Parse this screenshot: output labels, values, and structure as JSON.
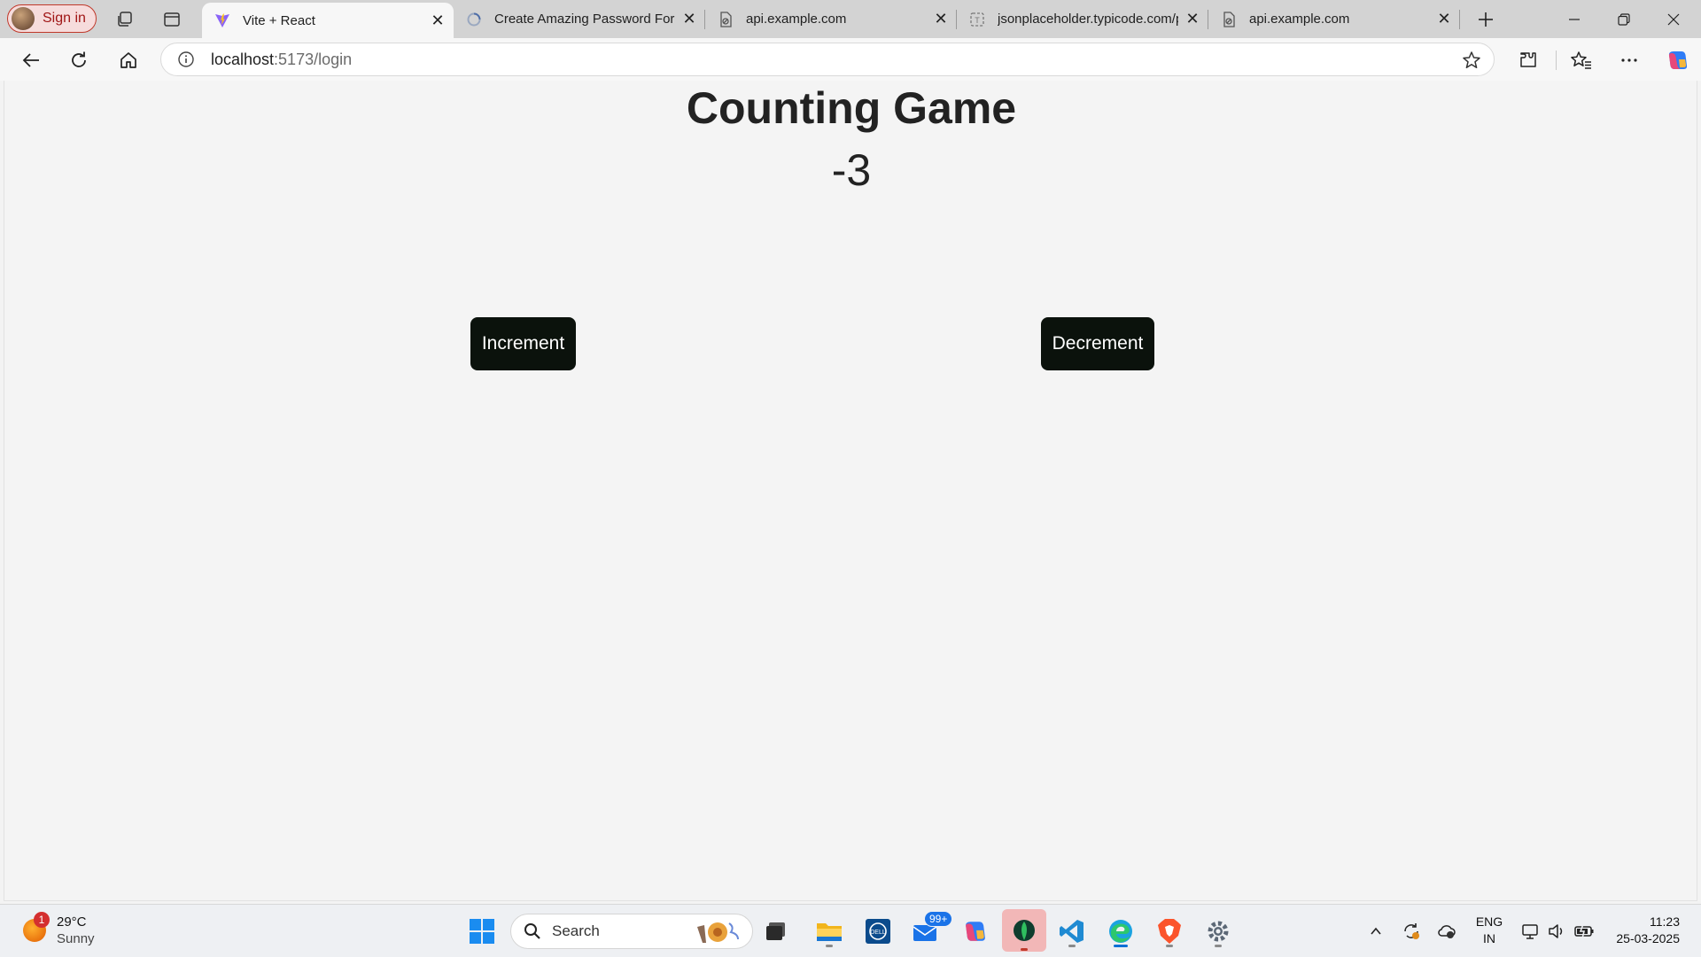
{
  "browser": {
    "signin_label": "Sign in",
    "tabs": [
      {
        "title": "Vite + React",
        "favicon": "vite-icon",
        "active": true
      },
      {
        "title": "Create Amazing Password Form",
        "favicon": "page-loading-icon",
        "active": false
      },
      {
        "title": "api.example.com",
        "favicon": "blocked-page-icon",
        "active": false
      },
      {
        "title": "jsonplaceholder.typicode.com/p",
        "favicon": "page-icon",
        "active": false
      },
      {
        "title": "api.example.com",
        "favicon": "blocked-page-icon",
        "active": false
      }
    ],
    "url_host": "localhost",
    "url_path": ":5173/login"
  },
  "page": {
    "title": "Counting Game",
    "count": "-3",
    "increment_label": "Increment",
    "decrement_label": "Decrement"
  },
  "taskbar": {
    "weather_temp": "29°C",
    "weather_condition": "Sunny",
    "weather_badge": "1",
    "search_label": "Search",
    "mail_badge": "99+",
    "lang_line1": "ENG",
    "lang_line2": "IN",
    "time": "11:23",
    "date": "25-03-2025"
  },
  "colors": {
    "button_bg": "#0b120c",
    "signin_border": "#c0392b",
    "accent": "#0a6fd6"
  }
}
